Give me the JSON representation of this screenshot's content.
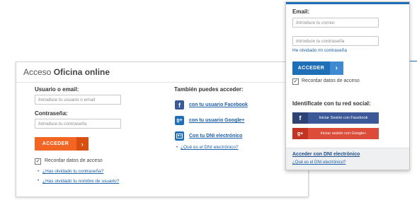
{
  "left": {
    "title_light": "Acceso",
    "title_bold": "Oficina online",
    "username_label": "Usuario o email:",
    "username_placeholder": "Introduce tu usuario o email",
    "password_label": "Contraseña:",
    "password_placeholder": "Introduce tu contraseña",
    "submit_label": "ACCEDER",
    "remember_label": "Recordar datos de acceso",
    "remember_checked": true,
    "forgot_password": "¿Has olvidado tu contraseña?",
    "forgot_username": "¿Has olvidado tu nombre de usuario?",
    "alt_access_title": "También puedes acceder:",
    "facebook_link": "con tu usuario Facebook",
    "google_link": "con tu usuario Google+",
    "dni_link": "Con tu DNI electrónico",
    "dni_info_link": "¿Qué es el DNI electrónico?"
  },
  "right": {
    "email_label": "Email:",
    "email_placeholder": "Introduce tu correo",
    "password_placeholder": "Introduce tu contraseña",
    "forgot_password": "He olvidado mi contraseña",
    "submit_label": "ACCEDER",
    "remember_label": "Recordar datos de acceso",
    "remember_checked": true,
    "social_title": "Identifícate con tu red social:",
    "facebook_button": "Iniciar Sesión con Facebook",
    "google_button": "Iniciar sesión con Google+",
    "dni_link": "Acceder con DNI electrónico",
    "dni_info_link": "¿Qué es el DNI electrónico?"
  },
  "icons": {
    "facebook": "f",
    "google": "g+",
    "dni": "id-card-icon",
    "arrow": "›",
    "check": "✓"
  },
  "colors": {
    "orange": "#f26522",
    "blue": "#1e6fb8",
    "facebook": "#3b5998",
    "google": "#dd4b39",
    "link": "#1d5fa8"
  }
}
